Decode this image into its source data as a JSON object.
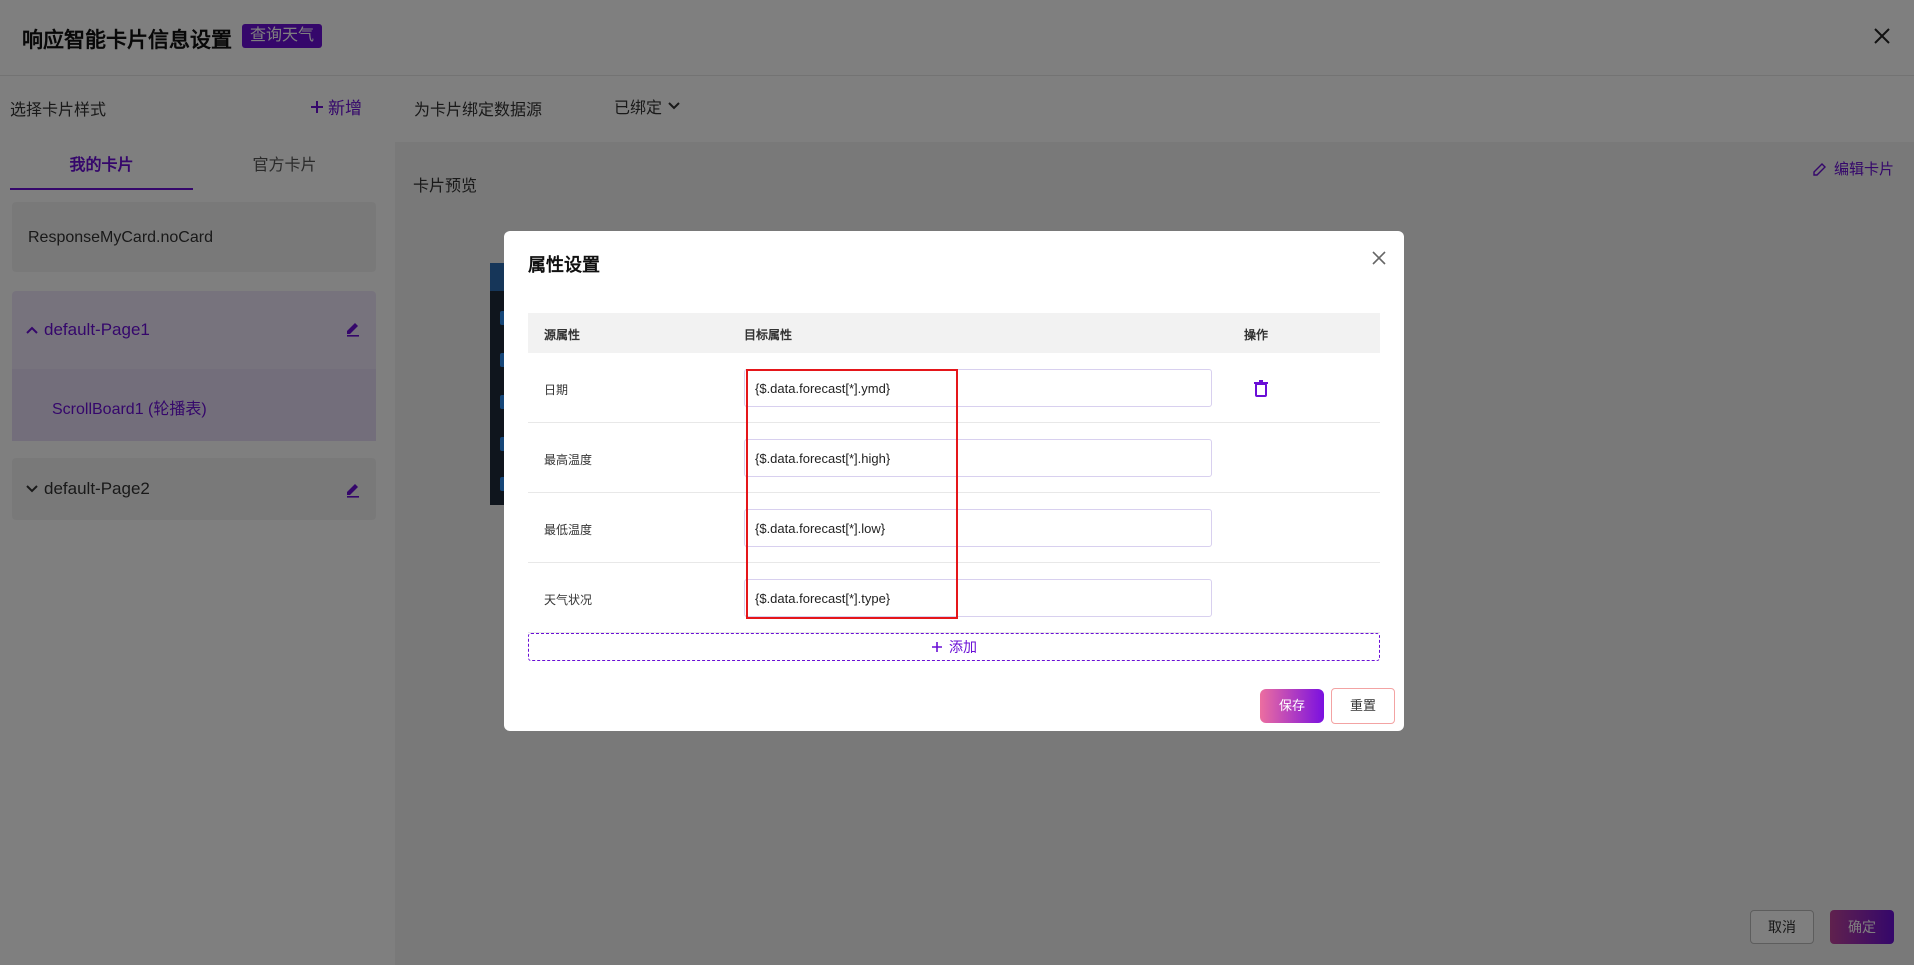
{
  "header": {
    "title": "响应智能卡片信息设置",
    "tag": "查询天气"
  },
  "left": {
    "heading": "选择卡片样式",
    "add_label": "新增",
    "tabs": [
      "我的卡片",
      "官方卡片"
    ],
    "no_card": "ResponseMyCard.noCard",
    "pages": [
      {
        "name": "default-Page1",
        "child": "ScrollBoard1 (轮播表)"
      },
      {
        "name": "default-Page2"
      }
    ]
  },
  "bind": {
    "label": "为卡片绑定数据源",
    "status": "已绑定"
  },
  "preview": {
    "label": "卡片预览",
    "edit": "编辑卡片"
  },
  "footer": {
    "cancel": "取消",
    "ok": "确定"
  },
  "modal": {
    "title": "属性设置",
    "columns": {
      "source": "源属性",
      "target": "目标属性",
      "action": "操作"
    },
    "rows": [
      {
        "source": "日期",
        "target": "{$.data.forecast[*].ymd}"
      },
      {
        "source": "最高温度",
        "target": "{$.data.forecast[*].high}"
      },
      {
        "source": "最低温度",
        "target": "{$.data.forecast[*].low}"
      },
      {
        "source": "天气状况",
        "target": "{$.data.forecast[*].type}"
      }
    ],
    "add": "添加",
    "save": "保存",
    "reset": "重置"
  },
  "colors": {
    "accent": "#6a0fd6",
    "highlight": "#e5161a"
  }
}
